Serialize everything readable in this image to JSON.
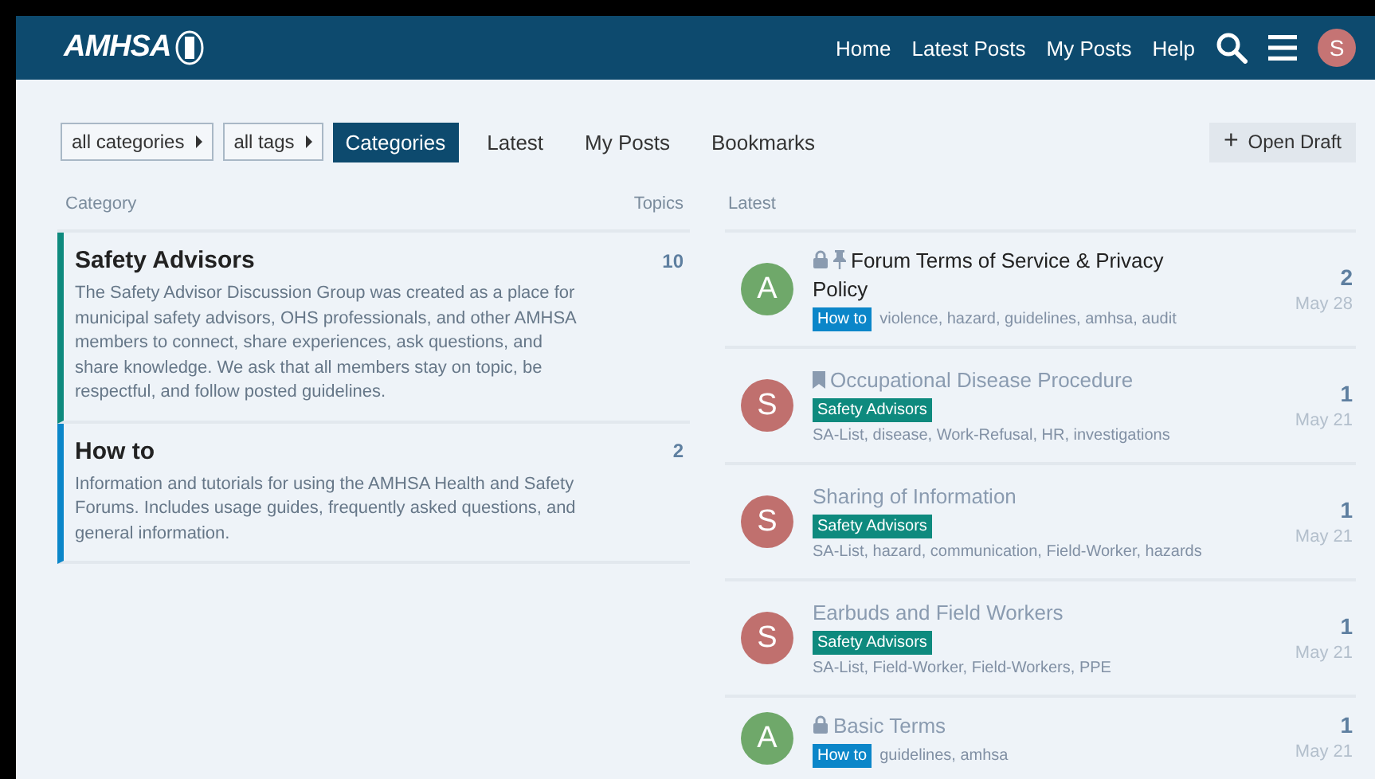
{
  "header": {
    "logo": "AMHSA",
    "nav": [
      "Home",
      "Latest Posts",
      "My Posts",
      "Help"
    ],
    "user_initial": "S"
  },
  "filters": {
    "dropdowns": [
      "all categories",
      "all tags"
    ],
    "tabs": [
      {
        "label": "Categories",
        "selected": true
      },
      {
        "label": "Latest",
        "selected": false
      },
      {
        "label": "My Posts",
        "selected": false
      },
      {
        "label": "Bookmarks",
        "selected": false
      }
    ],
    "action_icon": "+",
    "action": "Open Draft"
  },
  "categories": {
    "columns": [
      "Category",
      "Topics"
    ],
    "rows": [
      {
        "name": "Safety Advisors",
        "color": "#0e8a7e",
        "topics": "10",
        "description": "The Safety Advisor Discussion Group was created as a place for municipal safety advisors, OHS professionals, and other AMHSA members to connect, share experiences, ask questions, and share knowledge. We ask that all members stay on topic, be respectful, and follow posted guidelines."
      },
      {
        "name": "How to",
        "color": "#0b86c9",
        "topics": "2",
        "description": "Information and tutorials for using the AMHSA Health and Safety Forums. Includes usage guides, frequently asked questions, and general information."
      }
    ]
  },
  "latest": {
    "heading": "Latest",
    "topics": [
      {
        "avatar": {
          "letter": "A",
          "color": "#6fa86a"
        },
        "title": "Forum Terms of Service & Privacy Policy",
        "unread": true,
        "locked": true,
        "pinned": true,
        "bookmarked": false,
        "category": {
          "name": "How to",
          "color": "#0b86c9"
        },
        "tags": "violence, hazard, guidelines, amhsa, audit",
        "replies": "2",
        "date": "May 28"
      },
      {
        "avatar": {
          "letter": "S",
          "color": "#c0706e"
        },
        "title": "Occupational Disease Procedure",
        "unread": false,
        "locked": false,
        "pinned": false,
        "bookmarked": true,
        "category": {
          "name": "Safety Advisors",
          "color": "#0e8a7e"
        },
        "tags": "SA-List, disease, Work-Refusal, HR, investigations",
        "replies": "1",
        "date": "May 21"
      },
      {
        "avatar": {
          "letter": "S",
          "color": "#c0706e"
        },
        "title": "Sharing of Information",
        "unread": false,
        "locked": false,
        "pinned": false,
        "bookmarked": false,
        "category": {
          "name": "Safety Advisors",
          "color": "#0e8a7e"
        },
        "tags": "SA-List, hazard, communication, Field-Worker, hazards",
        "replies": "1",
        "date": "May 21"
      },
      {
        "avatar": {
          "letter": "S",
          "color": "#c0706e"
        },
        "title": "Earbuds and Field Workers",
        "unread": false,
        "locked": false,
        "pinned": false,
        "bookmarked": false,
        "category": {
          "name": "Safety Advisors",
          "color": "#0e8a7e"
        },
        "tags": "SA-List, Field-Worker, Field-Workers, PPE",
        "replies": "1",
        "date": "May 21"
      },
      {
        "avatar": {
          "letter": "A",
          "color": "#6fa86a"
        },
        "title": "Basic Terms",
        "unread": false,
        "locked": true,
        "pinned": false,
        "bookmarked": false,
        "category": {
          "name": "How to",
          "color": "#0b86c9"
        },
        "tags": "guidelines, amhsa",
        "replies": "1",
        "date": "May 21"
      }
    ]
  }
}
